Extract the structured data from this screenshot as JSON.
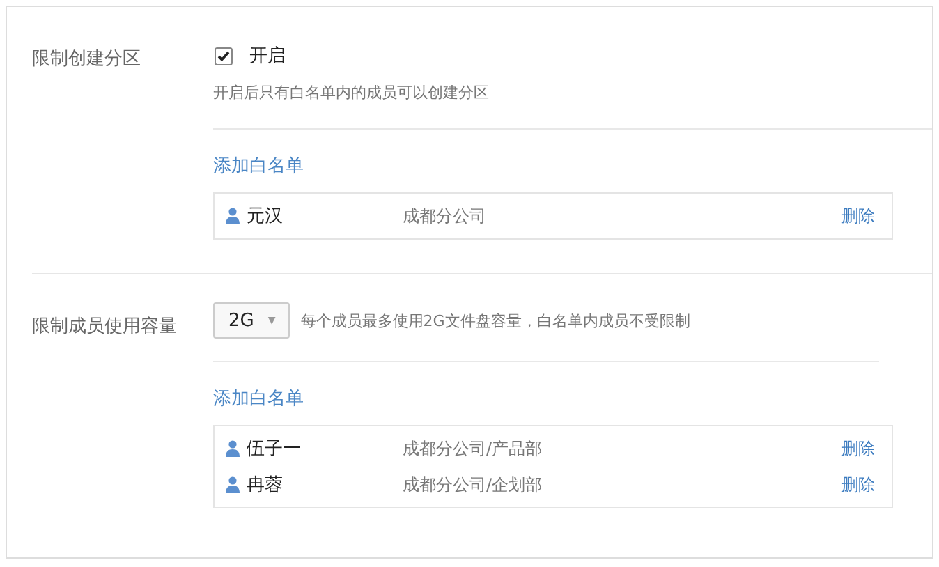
{
  "sections": [
    {
      "label": "限制创建分区",
      "control": {
        "kind": "checkbox",
        "checked": true,
        "label": "开启"
      },
      "hint": "开启后只有白名单内的成员可以创建分区",
      "add_link": "添加白名单",
      "members": [
        {
          "name": "元汉",
          "department": "成都分公司",
          "action": "删除"
        }
      ]
    },
    {
      "label": "限制成员使用容量",
      "control": {
        "kind": "dropdown",
        "value": "2G",
        "caret": "▼"
      },
      "hint": "每个成员最多使用2G文件盘容量，白名单内成员不受限制",
      "add_link": "添加白名单",
      "members": [
        {
          "name": "伍子一",
          "department": "成都分公司/产品部",
          "action": "删除"
        },
        {
          "name": "冉蓉",
          "department": "成都分公司/企划部",
          "action": "删除"
        }
      ]
    }
  ]
}
